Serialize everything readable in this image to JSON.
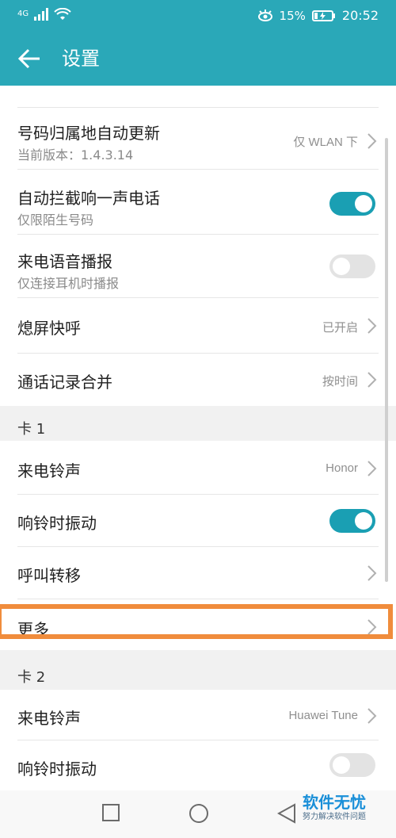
{
  "status_bar": {
    "network": "4G",
    "battery_percent": "15%",
    "time": "20:52"
  },
  "header": {
    "title": "设置"
  },
  "settings": {
    "number_auto_update": {
      "title": "号码归属地自动更新",
      "subtitle": "当前版本：1.4.3.14",
      "value": "仅 WLAN 下"
    },
    "block_one_ring": {
      "title": "自动拦截响一声电话",
      "subtitle": "仅限陌生号码",
      "enabled": true
    },
    "voice_announce": {
      "title": "来电语音播报",
      "subtitle": "仅连接耳机时播报",
      "enabled": false
    },
    "screen_off_call": {
      "title": "熄屏快呼",
      "value": "已开启"
    },
    "merge_call_log": {
      "title": "通话记录合并",
      "value": "按时间"
    }
  },
  "card1": {
    "label": "卡 1",
    "ringtone": {
      "title": "来电铃声",
      "value": "Honor"
    },
    "vibrate": {
      "title": "响铃时振动",
      "enabled": true
    },
    "forwarding": {
      "title": "呼叫转移"
    },
    "more": {
      "title": "更多"
    }
  },
  "card2": {
    "label": "卡 2",
    "ringtone": {
      "title": "来电铃声",
      "value": "Huawei Tune"
    },
    "vibrate": {
      "title": "响铃时振动",
      "enabled": false
    }
  },
  "watermark": {
    "title": "软件无忧",
    "subtitle": "努力解决软件问题"
  },
  "colors": {
    "accent": "#2aa8b8",
    "toggle_on": "#1a9fb3",
    "highlight": "#f08c3c"
  }
}
